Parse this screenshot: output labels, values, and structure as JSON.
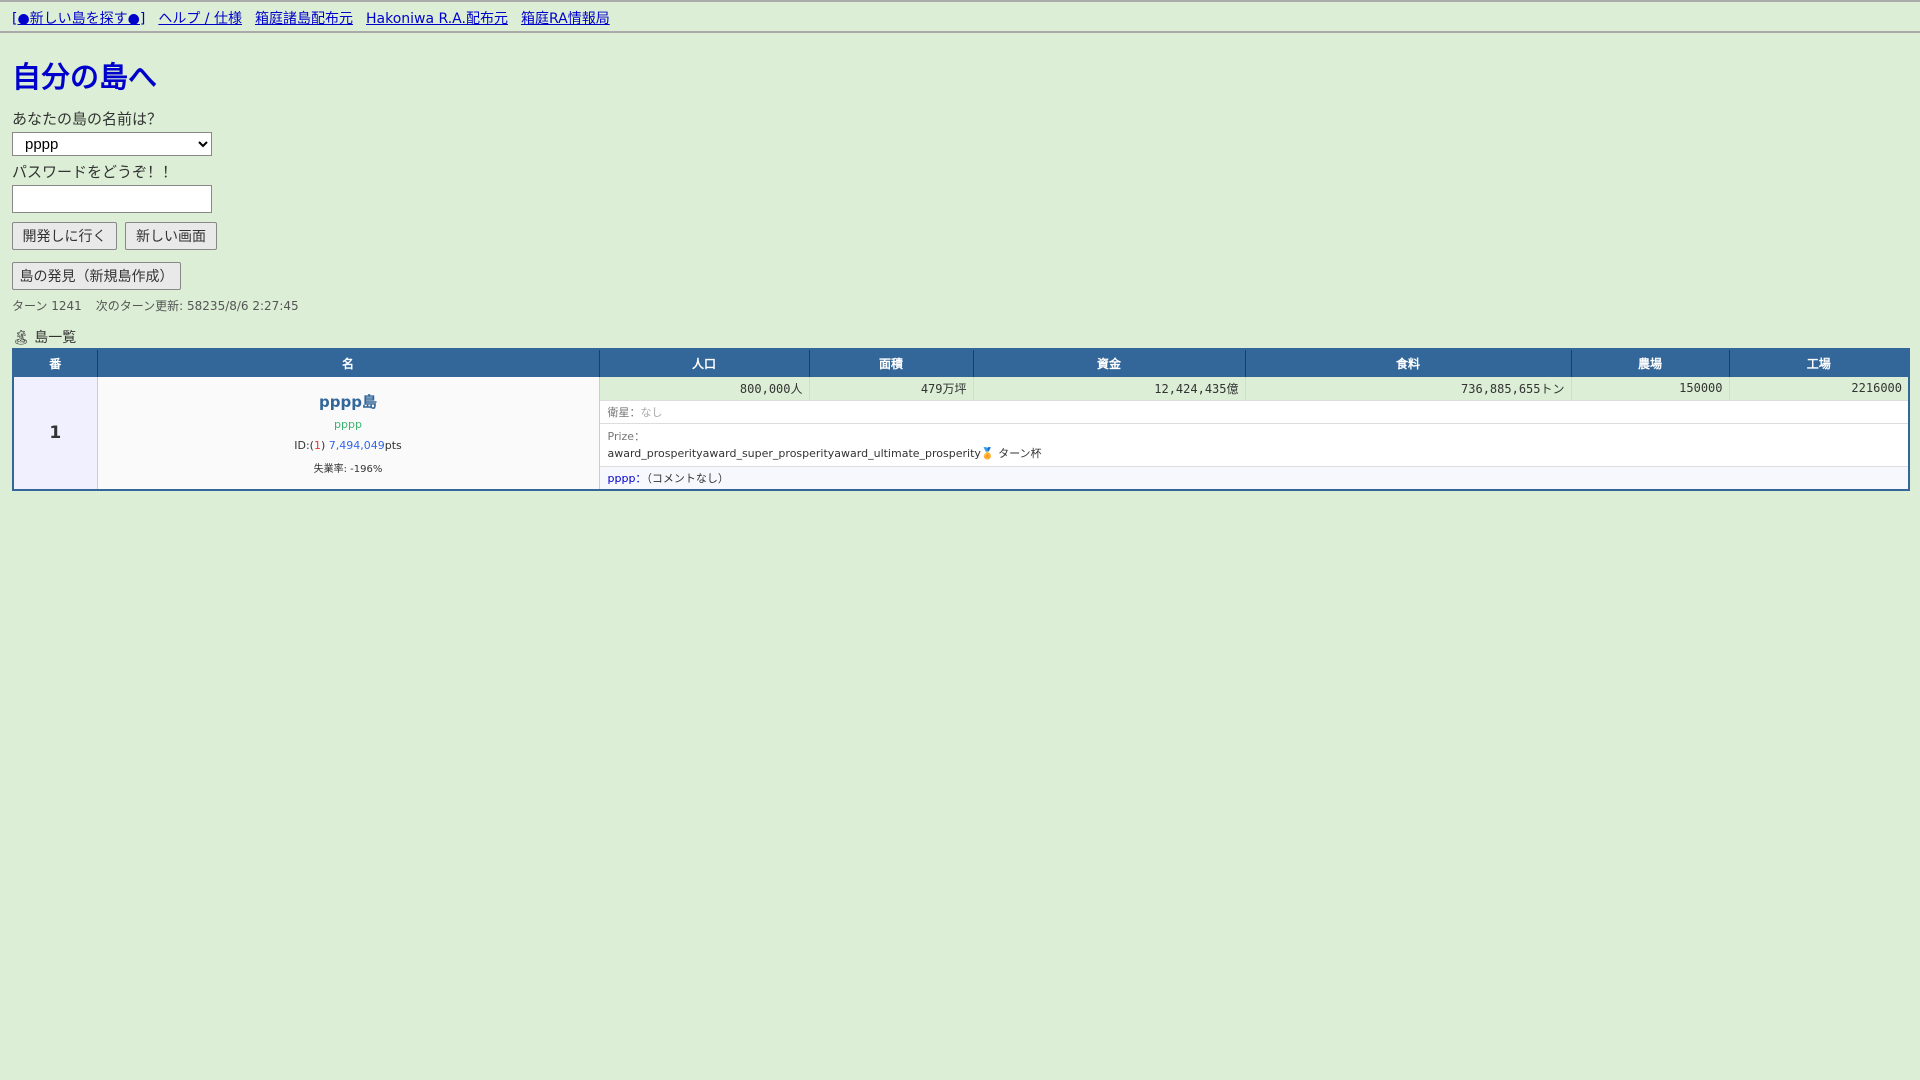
{
  "nav": [
    "[●新しい島を探す●]",
    "ヘルプ / 仕様",
    "箱庭諸島配布元",
    "Hakoniwa R.A.配布元",
    "箱庭RA情報局"
  ],
  "title": "自分の島へ",
  "form": {
    "name_label": "あなたの島の名前は？",
    "selected_island": "pppp",
    "password_label": "パスワードをどうぞ！！",
    "password_value": "",
    "go_button": "開発しに行く",
    "new_window_button": "新しい画面",
    "discover_button": "島の発見（新規島作成）"
  },
  "status": {
    "turn": "ターン 1241",
    "next_update": "次のターン更新: 58235/8/6 2:27:45"
  },
  "list": {
    "title": "島一覧",
    "icon": "island-icon",
    "headers": [
      "番",
      "名",
      "人口",
      "面積",
      "資金",
      "食料",
      "農場",
      "工場"
    ],
    "rows": [
      {
        "rank": "1",
        "name": "pppp島",
        "owner": "pppp",
        "id_prefix": "ID:(",
        "id": "1",
        "id_suffix": ") ",
        "points": "7,494,049",
        "pts": "pts",
        "unemployment": "失業率: -196%",
        "population": "800,000人",
        "area": "479万坪",
        "funds": "12,424,435億",
        "food": "736,885,655トン",
        "farm": "150000",
        "factory": "2216000",
        "satellite_label": "衛星：",
        "satellite": "なし",
        "prize_label": "Prize：",
        "prize": "award_prosperityaward_super_prosperityaward_ultimate_prosperity",
        "prize_turn": "ターン杯",
        "comment_owner": "pppp：",
        "comment": "（コメントなし）"
      }
    ]
  }
}
